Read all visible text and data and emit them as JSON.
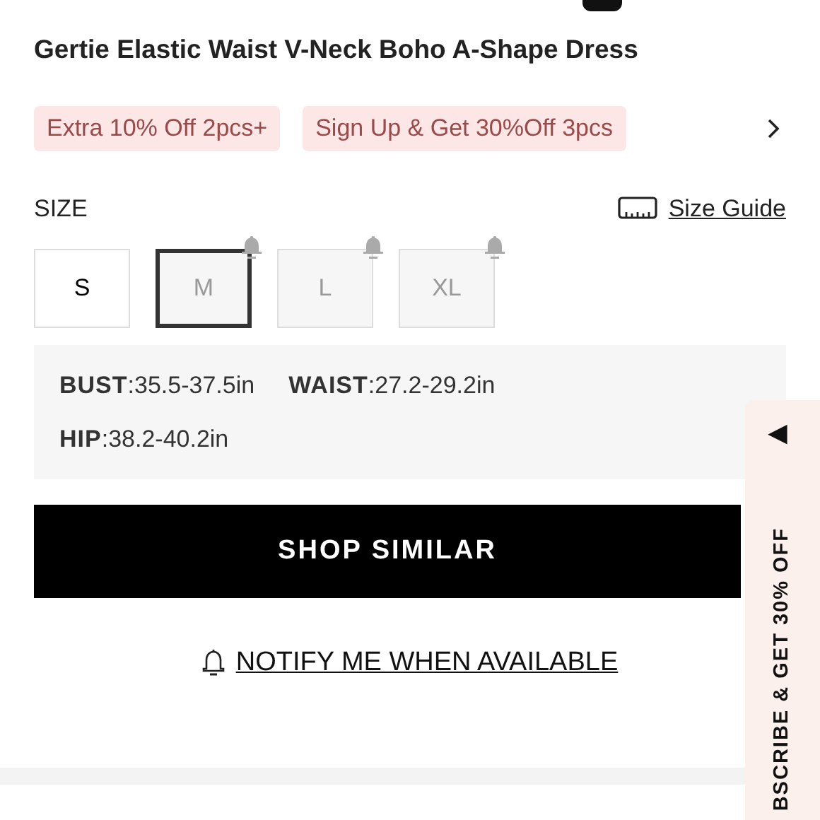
{
  "product": {
    "title": "Gertie Elastic Waist V-Neck Boho A-Shape Dress"
  },
  "promos": [
    "Extra 10% Off 2pcs+",
    "Sign Up & Get 30%Off 3pcs"
  ],
  "size_header": {
    "label": "SIZE",
    "guide_link": "Size Guide"
  },
  "sizes": [
    {
      "label": "S",
      "selected": false,
      "sold_out": false
    },
    {
      "label": "M",
      "selected": true,
      "sold_out": true
    },
    {
      "label": "L",
      "selected": false,
      "sold_out": true
    },
    {
      "label": "XL",
      "selected": false,
      "sold_out": true
    }
  ],
  "measurements": [
    "**BUST**:35.5-37.5in",
    "**WAIST**:27.2-29.2in",
    "**HIP**:38.2-40.2in"
  ],
  "shop_button": "SHOP SIMILAR",
  "notify_link": "NOTIFY ME WHEN AVAILABLE",
  "side_tab": {
    "label": "BSCRIBE & GET 30% OFF",
    "arrow": "◀"
  }
}
